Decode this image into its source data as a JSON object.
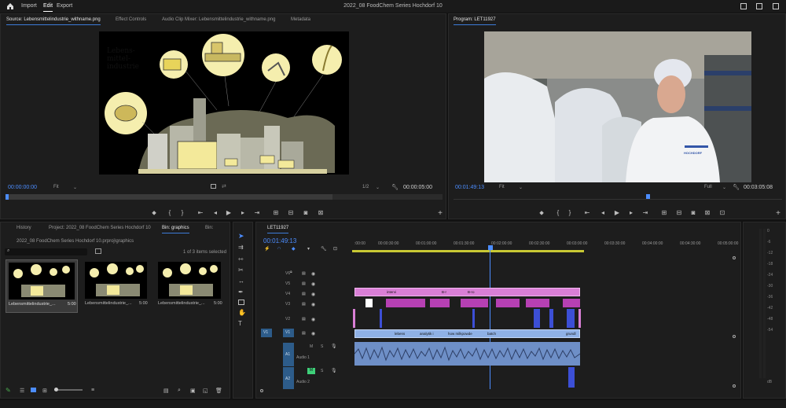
{
  "menu": {
    "import": "Import",
    "edit": "Edit",
    "export": "Export"
  },
  "app_title": "2022_08 FoodChem Series Hochdorf 10",
  "source_panel": {
    "tabs": [
      "Source: Lebensmittelindustrie_withname.png",
      "Effect Controls",
      "Audio Clip Mixer: Lebensmittelindustrie_withname.png",
      "Metadata"
    ],
    "image_title": "Lebens-\nmittel-\nindustrie",
    "timecode_in": "00:00:00:00",
    "zoom": "Fit",
    "resolution": "1/2",
    "timecode_duration": "00:00:05:00"
  },
  "program_panel": {
    "tab": "Program: LET11927",
    "timecode_in": "00:01:49:13",
    "zoom": "Fit",
    "resolution": "Full",
    "timecode_duration": "00:03:05:08",
    "shirt_logo": "HOCHDORF"
  },
  "project_panel": {
    "tabs": [
      "History",
      "Project: 2022_08 FoodChem Series Hochdorf 10",
      "Bin: graphics",
      "Bin:"
    ],
    "path": "2022_08 FoodChem Series Hochdorf 10.prproj\\graphics",
    "selection_count": "1 of 3 items selected",
    "items": [
      {
        "name": "Lebensmittelindustrie_...",
        "duration": "5:00"
      },
      {
        "name": "Lebensmittelindustrie_...",
        "duration": "5:00"
      },
      {
        "name": "Lebensmittelindustrie_...",
        "duration": "5:00"
      }
    ]
  },
  "timeline": {
    "tab": "LET11927",
    "timecode": "00:01:49:13",
    "ruler": [
      ":00:00",
      "00:00:30:00",
      "00:01:00:00",
      "00:01:30:00",
      "00:02:00:00",
      "00:02:30:00",
      "00:03:00:00",
      "00:03:30:00",
      "00:04:00:00",
      "00:04:30:00",
      "00:05:00:00"
    ],
    "video_tracks": [
      "V6",
      "V5",
      "V4",
      "V3",
      "V2",
      "V1"
    ],
    "audio_tracks": [
      {
        "src": "A1",
        "name": "A1",
        "label": "Audio 1"
      },
      {
        "src": "A2",
        "name": "A2",
        "label": "Audio 2"
      }
    ],
    "v1_source": "V1",
    "v4_clips": [
      "intervi",
      "B-r",
      "B-ro"
    ],
    "v1_clips": [
      "lebens",
      "analytik i",
      "how milkpowde",
      "batch",
      "grundl"
    ]
  },
  "meter": {
    "labels": [
      "0",
      "-6",
      "-12",
      "-18",
      "-24",
      "-30",
      "-36",
      "-42",
      "-48",
      "-54"
    ],
    "unit": "dB"
  },
  "colors": {
    "accent": "#3d7bd8",
    "timecode": "#4c8dff",
    "clip_pink": "#d97fd6",
    "clip_blue": "#3c4fd6",
    "clip_audio": "#6e8fc7"
  }
}
